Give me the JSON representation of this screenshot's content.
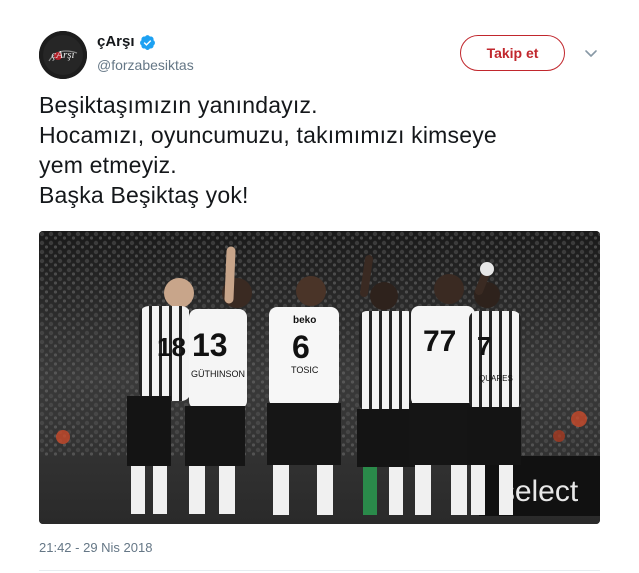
{
  "user": {
    "display_name": "çArşı",
    "handle": "@forzabesiktas",
    "verified": true,
    "avatar_text": "çArşı"
  },
  "actions": {
    "follow_label": "Takip et",
    "more_icon": "chevron-down-icon"
  },
  "tweet": {
    "lines": [
      "Beşiktaşımızın yanındayız.",
      "Hocamızı, oyuncumuzu, takımımızı kimseye",
      "yem etmeyiz.",
      "Başka Beşiktaş yok!"
    ],
    "timestamp": "21:42 - 29 Nis 2018"
  },
  "photo": {
    "jersey_numbers": [
      "18",
      "13",
      "6",
      "77",
      "7"
    ],
    "jersey_names": [
      "GÜTHINSON",
      "TOSIC",
      "QUARES"
    ],
    "sponsor": "beko",
    "board_text": "select"
  },
  "colors": {
    "follow_accent": "#c1272d",
    "verified_blue": "#1da1f2",
    "muted_text": "#657786"
  }
}
